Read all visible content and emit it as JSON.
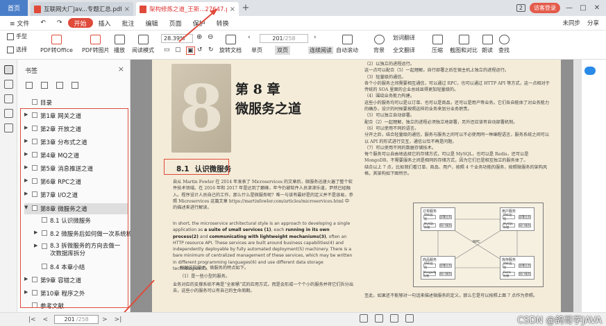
{
  "titlebar": {
    "home": "首页",
    "tabs": [
      {
        "label": "互联网大厂Jav...专题汇总.pdf",
        "active": false
      },
      {
        "label": "架构修炼之道_王新...27647.pdf",
        "active": true
      }
    ],
    "badge": "2",
    "login": "访客登录"
  },
  "menubar": {
    "file": "≡ 文件",
    "items": [
      "开始",
      "插入",
      "批注",
      "编辑",
      "页面",
      "保护",
      "转换"
    ],
    "right": [
      "未同步",
      "分享"
    ]
  },
  "toolbar": {
    "hand": "手型",
    "select": "选择",
    "pdf_office": "PDF转Office",
    "pdf_image": "PDF转图片",
    "play": "播放",
    "read_mode": "阅读模式",
    "zoom": "28.39%",
    "rotate": "旋转文档",
    "single": "单页",
    "double": "双页",
    "continuous": "连续阅读",
    "page_current": "201",
    "page_total": "/258",
    "auto_scroll": "自动滚动",
    "background": "背景",
    "translate": "划词翻译",
    "full_translate": "全文翻译",
    "compress": "压缩",
    "screenshot": "截图和对比",
    "read_aloud": "朗读",
    "find": "查找"
  },
  "panel": {
    "title": "书签",
    "toc": "目录",
    "bookmarks": [
      "第1章 网关之道",
      "第2章 开放之道",
      "第3章 分布式之道",
      "第4章 MQ之道",
      "第5章 消息推送之道",
      "第6章 RPC之道",
      "第7章 I/O之道",
      "第8章 微服务之道",
      "8.1 认识微服务",
      "8.2 微服务后如何做一次系统梳理",
      "8.3 拆微服务的方向去做一次数据库拆分",
      "8.4 本章小结",
      "第9章 容错之道",
      "第10章 程序之外",
      "参考文献"
    ]
  },
  "document": {
    "chapter_num": "第 8 章",
    "chapter_title": "微服务之道",
    "deco": "8",
    "section_num": "8.1",
    "section_title": "认识微服务",
    "para1": "自从 Martin Fowler 在 2014 年发表了 Microservices 的文章后，微服务迅速火遍了整个软件技术领域。在 2016 年和 2017 年是达到了巅峰，年今仍被软件人员津津乐道，尹然已经融入。程序设计人员自己的工作，那么什么是微服务呢？唯一与该有最好是的定义并不是容易，参照 Microservices 这篇文章 https://martinfowler.com/articles/microservices.html 中的描述来进行解读。",
    "para2_pre": "In short, the microservice architectural style is an approach to developing a single application as ",
    "para2_b1": "a suite of small services (1)",
    "para2_mid": ", each ",
    "para2_b2": "running in its own process(2)",
    "para2_and": " and ",
    "para2_b3": "communicating with lightweight mechanisms(3)",
    "para2_rest": ", often an HTTP resource API. These services are built around business capabilities(4) and independently deployable by fully automated deployment(5) machinery. There is a bare minimum of centralized management of these services, which may be written in different programming languages(6) and use different data storage technologies(7).",
    "para3": "根据这段描述，微服务的特点如下。",
    "para4": "（1）是一些小型的服务。",
    "para5": "业务对应的支撑系统不再是“全家桶”式的应用方式，而是会形成一个个小的服务并将它们拆分出去，这些小的服务可以有自己的生命周期。",
    "right_col": "（2）以独立的进程运行。\n这一点可以配合（5）一起理解。自行部署之后在宿主机上独立的进程运行。\n（3）轻量级的通信。\n各个小的服务之间需要相互通信，可以通过 RPC，也可以通过 HTTP API 等方式，这一点相对于传统的 SOA 里面的企业总线显得更加轻量级的。\n（4）围绕业务能力构建。\n这些小的服务均可以是以订单、也可以是商品，还可以是用户等业务。它们各自能体了对业务能力的确办，设计的时候要按照这样的业务来划分业务职责。\n（5）可以独立自动部署。\n配合（2）一起理解，独立的进程必须独立地部署，另外还应该有自动部署机制。\n（6）可以使用不同的语言。\n分开之后，结合轻量级的通信，服务与服务之间可以不必使用同一种编程语言，服务系统之间可以以 API 的形式进行交互，通信以恰不再是问题。\n（7）可以使用不同的数据存储技术。\n每个服务可以自由地选择它的存储方式，可以是 MySQL，也可以是 Redis，还可以是 MongoDB，不需要服务之间是相同的存储方式，因为它们已是相互独立的服务体了。\n结合以上 7 点，比如我们看订单、商品、用户，按照 4 个业务功能的服务，按照微服务的架构风格，其架构如下图所示。",
    "diagram": {
      "rpc": "RPC",
      "groups": [
        {
          "name": "订单服务",
          "items": [
            "Web应用",
            "部署业务",
            "MySQL 存储",
            "接口服务"
          ]
        },
        {
          "name": "用户服务",
          "items": [
            "Web应用",
            "部署业务",
            "MySQL 存储",
            "接口服务"
          ]
        },
        {
          "name": "商品服务",
          "items": [
            "Web应用",
            "部署业务",
            "Mongodb 存储",
            "接口服务"
          ]
        },
        {
          "name": "库存服务",
          "items": [
            "Web应用",
            "部署业务",
            "Redis 存储",
            "接口服务"
          ]
        }
      ]
    },
    "bottom_line": "至此，如果还不能够对一句话来描述微服务的定义，那么它是可以按照上面 7 点作为参照。"
  },
  "status": {
    "page_current": "201",
    "page_total": "/258"
  },
  "watermark": "CSDN @鸽哥学JAVA"
}
